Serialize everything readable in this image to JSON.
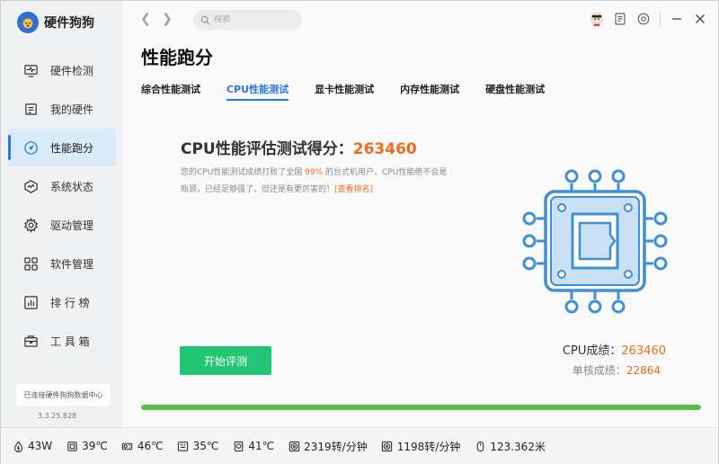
{
  "app": {
    "name": "硬件狗狗"
  },
  "sidebar": {
    "items": [
      {
        "label": "硬件检测",
        "icon": "monitor-pulse-icon"
      },
      {
        "label": "我的硬件",
        "icon": "hardware-list-icon"
      },
      {
        "label": "性能跑分",
        "icon": "speedometer-icon"
      },
      {
        "label": "系统状态",
        "icon": "system-wave-icon"
      },
      {
        "label": "驱动管理",
        "icon": "gear-icon"
      },
      {
        "label": "软件管理",
        "icon": "apps-grid-icon"
      },
      {
        "label": "排 行 榜",
        "icon": "ranking-icon"
      },
      {
        "label": "工 具 箱",
        "icon": "toolbox-icon"
      }
    ],
    "active_index": 2,
    "connection": "已连接硬件狗狗数据中心",
    "version": "3.3.25.828"
  },
  "topbar": {
    "search_placeholder": "搜索"
  },
  "page": {
    "title": "性能跑分",
    "tabs": [
      "综合性能测试",
      "CPU性能测试",
      "显卡性能测试",
      "内存性能测试",
      "硬盘性能测试"
    ],
    "active_tab": 1
  },
  "cpu_test": {
    "heading": "CPU性能评估测试得分：",
    "score": "263460",
    "desc_before": "您的CPU性能测试成绩打败了全国 ",
    "desc_percent": "99%",
    "desc_after": " 的台式机用户，CPU性能绝不会是瓶颈，已经足够强了，但还是有更厉害的！",
    "desc_link": "[查看排名]",
    "start_button": "开始评测",
    "result_label": "CPU成绩：",
    "result_value": "263460",
    "single_label": "单核成绩：",
    "single_value": "22864",
    "progress": 1.0
  },
  "statusbar": [
    {
      "icon": "power-drop-icon",
      "value": "43W"
    },
    {
      "icon": "cpu-temp-icon",
      "value": "39℃"
    },
    {
      "icon": "gpu-temp-icon",
      "value": "46℃"
    },
    {
      "icon": "board-temp-icon",
      "value": "35℃"
    },
    {
      "icon": "disk-temp-icon",
      "value": "41℃"
    },
    {
      "icon": "fan-icon",
      "value": "2319转/分钟"
    },
    {
      "icon": "fan-icon",
      "value": "1198转/分钟"
    },
    {
      "icon": "mouse-icon",
      "value": "123.362米"
    }
  ],
  "colors": {
    "accent": "#2b78e4",
    "score": "#f06a1c",
    "start_button": "#22c574",
    "progress": "#55c14a",
    "chip": "#3d8fd6"
  }
}
